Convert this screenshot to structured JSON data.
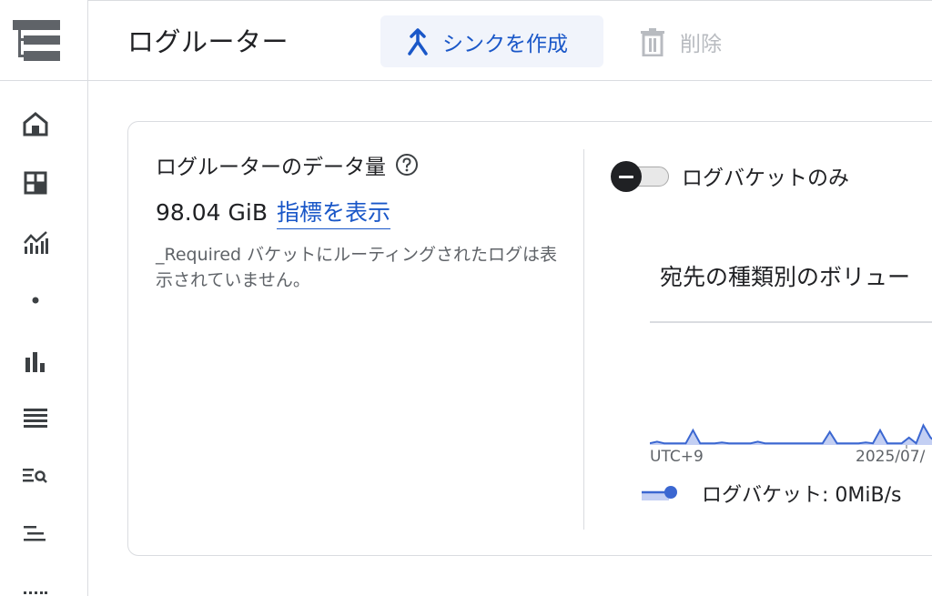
{
  "rail": {
    "icons": [
      "menu-icon",
      "home-icon",
      "dashboard-icon",
      "analytics-icon",
      "dot-icon",
      "bar-chart-icon",
      "list-icon",
      "search-list-icon",
      "sort-icon",
      "grid-icon"
    ]
  },
  "header": {
    "title": "ログルーター",
    "create_sink_label": "シンクを作成",
    "delete_label": "削除"
  },
  "card": {
    "volume_label": "ログルーターのデータ量",
    "volume_value": "98.04 GiB",
    "metrics_link": "指標を表示",
    "note": "_Required バケットにルーティングされたログは表示されていません。",
    "toggle_label": "ログバケットのみ",
    "chart_title": "宛先の種類別のボリュー",
    "axis_left": "UTC+9",
    "axis_right": "2025/07/",
    "legend_label": "ログバケット: 0MiB/s"
  },
  "colors": {
    "accent": "#1a57c8",
    "chart_line": "#3b67d1",
    "chart_fill": "#c3cff3"
  },
  "chart_data": {
    "type": "area",
    "series": [
      {
        "name": "ログバケット",
        "values": [
          0.2,
          0.4,
          0.2,
          0.2,
          0.2,
          0.2,
          1.8,
          0.2,
          0.2,
          0.2,
          0.3,
          0.2,
          0.2,
          0.2,
          0.2,
          0.4,
          0.2,
          0.2,
          0.2,
          0.2,
          0.2,
          0.2,
          0.2,
          0.2,
          0.2,
          1.6,
          0.2,
          0.2,
          0.2,
          0.2,
          0.3,
          0.2,
          1.8,
          0.2,
          0.2,
          0.2,
          0.9,
          0.2,
          2.4,
          0.9,
          0.2,
          1.6,
          0.2,
          0.3
        ]
      }
    ],
    "xlabel": "",
    "ylabel": "",
    "grid": false
  }
}
